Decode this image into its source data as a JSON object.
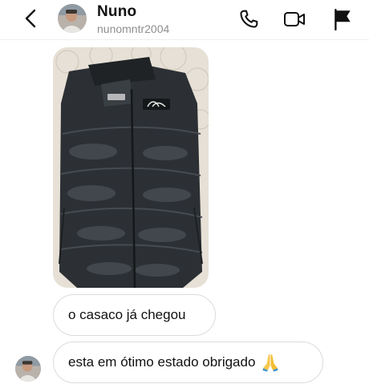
{
  "header": {
    "name": "Nuno",
    "username": "nunomntr2004",
    "back_icon": "chevron-left-icon",
    "actions": [
      "phone-icon",
      "video-camera-icon",
      "flag-icon"
    ]
  },
  "messages": [
    {
      "type": "image",
      "alt_icon": "jacket-photo"
    },
    {
      "type": "text",
      "text": "o casaco já chegou"
    },
    {
      "type": "text",
      "text": "esta em ótimo estado obrigado",
      "emoji_icon": "folded-hands-emoji"
    }
  ],
  "colors": {
    "text": "#111111",
    "secondary_text": "#8e8e8e",
    "bubble_border": "#dbdbdb",
    "divider": "#efefef",
    "jacket": "#2c3034",
    "background": "#ffffff"
  }
}
